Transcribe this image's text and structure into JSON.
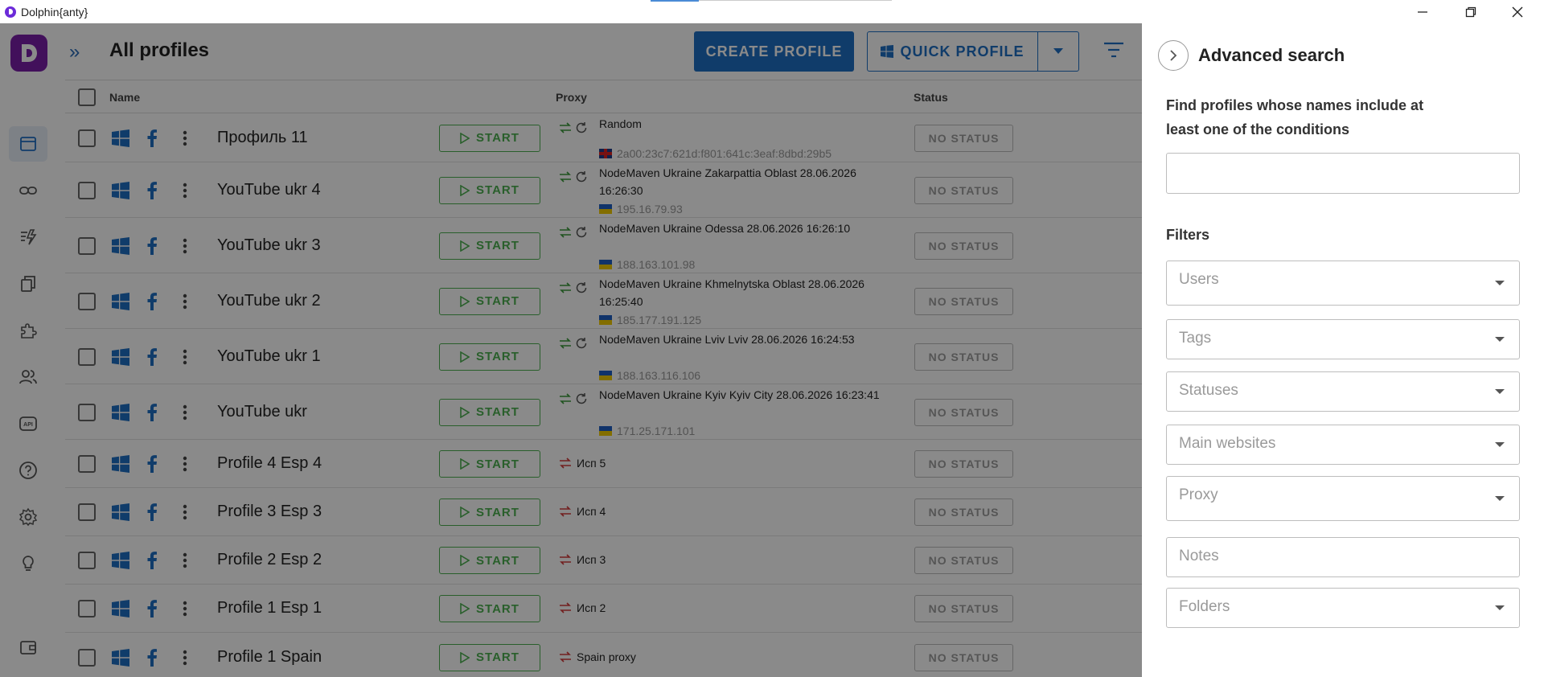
{
  "window": {
    "title": "Dolphin{anty}",
    "controls": [
      "minimize-icon",
      "maximize-icon",
      "close-icon"
    ]
  },
  "sidebar": {
    "logo_letter": "D",
    "items": [
      {
        "name": "browser-profiles-icon",
        "active": true
      },
      {
        "name": "proxy-link-icon",
        "active": false
      },
      {
        "name": "automation-icon",
        "active": false
      },
      {
        "name": "clone-icon",
        "active": false
      },
      {
        "name": "extensions-icon",
        "active": false
      },
      {
        "name": "team-icon",
        "active": false
      },
      {
        "name": "api-icon",
        "active": false,
        "label": "API"
      },
      {
        "name": "help-icon",
        "active": false
      },
      {
        "name": "settings-icon",
        "active": false
      },
      {
        "name": "tips-icon",
        "active": false
      },
      {
        "name": "wallet-icon",
        "active": false
      }
    ]
  },
  "header": {
    "title": "All profiles",
    "create_button": "CREATE PROFILE",
    "quick_button": "QUICK PROFILE"
  },
  "table": {
    "columns": {
      "name": "Name",
      "proxy": "Proxy",
      "status": "Status"
    },
    "start_label": "START",
    "rows": [
      {
        "name": "Профиль 11",
        "proxy": "Random",
        "ip": "2a00:23c7:621d:f801:641c:3eaf:8dbd:29b5",
        "flag": "gb",
        "status": "NO STATUS"
      },
      {
        "name": "YouTube ukr 4",
        "proxy": "NodeMaven Ukraine Zakarpattia Oblast 28.06.2026 16:26:30",
        "ip": "195.16.79.93",
        "flag": "ua",
        "status": "NO STATUS"
      },
      {
        "name": "YouTube ukr 3",
        "proxy": "NodeMaven Ukraine Odessa 28.06.2026 16:26:10",
        "ip": "188.163.101.98",
        "flag": "ua",
        "status": "NO STATUS"
      },
      {
        "name": "YouTube ukr 2",
        "proxy": "NodeMaven Ukraine Khmelnytska Oblast 28.06.2026 16:25:40",
        "ip": "185.177.191.125",
        "flag": "ua",
        "status": "NO STATUS"
      },
      {
        "name": "YouTube ukr 1",
        "proxy": "NodeMaven Ukraine Lviv Lviv 28.06.2026 16:24:53",
        "ip": "188.163.116.106",
        "flag": "ua",
        "status": "NO STATUS"
      },
      {
        "name": "YouTube ukr",
        "proxy": "NodeMaven Ukraine Kyiv Kyiv City 28.06.2026 16:23:41",
        "ip": "171.25.171.101",
        "flag": "ua",
        "status": "NO STATUS"
      },
      {
        "name": "Profile 4 Esp 4",
        "proxy": "Исп 5",
        "status": "NO STATUS"
      },
      {
        "name": "Profile 3 Esp 3",
        "proxy": "Исп 4",
        "status": "NO STATUS"
      },
      {
        "name": "Profile 2 Esp 2",
        "proxy": "Исп 3",
        "status": "NO STATUS"
      },
      {
        "name": "Profile 1 Esp 1",
        "proxy": "Исп 2",
        "status": "NO STATUS"
      },
      {
        "name": "Profile 1 Spain",
        "proxy": "Spain proxy",
        "status": "NO STATUS"
      }
    ]
  },
  "advanced_search": {
    "title": "Advanced search",
    "hint": "Find profiles whose names include at least one of the conditions",
    "search_value": "",
    "filters_title": "Filters",
    "fields": [
      {
        "label": "Users",
        "dropdown": true
      },
      {
        "label": "Tags",
        "dropdown": true
      },
      {
        "label": "Statuses",
        "dropdown": true
      },
      {
        "label": "Main websites",
        "dropdown": true
      },
      {
        "label": "Proxy",
        "dropdown": true
      },
      {
        "label": "Notes",
        "dropdown": false
      },
      {
        "label": "Folders",
        "dropdown": true
      }
    ]
  },
  "colors": {
    "accent": "#1f6fc4",
    "start_green": "#4caf50",
    "logo_purple": "#7a1fa8"
  }
}
